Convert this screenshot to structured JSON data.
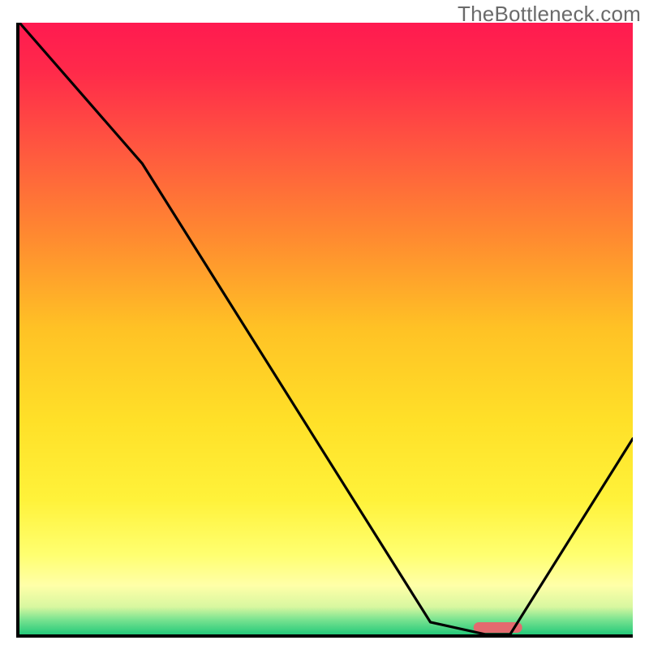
{
  "watermark": "TheBottleneck.com",
  "chart_data": {
    "type": "line",
    "title": "",
    "xlabel": "",
    "ylabel": "",
    "xlim": [
      0,
      100
    ],
    "ylim": [
      0,
      100
    ],
    "grid": false,
    "series": [
      {
        "name": "bottleneck-curve",
        "x": [
          0,
          20,
          67,
          76,
          80,
          100
        ],
        "y": [
          100,
          77,
          2,
          0,
          0,
          32
        ]
      }
    ],
    "marker": {
      "shape": "rounded-bar",
      "x": 78,
      "y": 0,
      "color": "#e46a6f"
    },
    "gradient": {
      "type": "vertical",
      "stops": [
        {
          "offset": 0.0,
          "color": "#ff1a50"
        },
        {
          "offset": 0.08,
          "color": "#ff2a4a"
        },
        {
          "offset": 0.2,
          "color": "#ff5540"
        },
        {
          "offset": 0.35,
          "color": "#ff8a30"
        },
        {
          "offset": 0.5,
          "color": "#ffc225"
        },
        {
          "offset": 0.65,
          "color": "#ffe028"
        },
        {
          "offset": 0.78,
          "color": "#fff23a"
        },
        {
          "offset": 0.87,
          "color": "#ffff70"
        },
        {
          "offset": 0.92,
          "color": "#ffffa8"
        },
        {
          "offset": 0.955,
          "color": "#d8f7a0"
        },
        {
          "offset": 0.975,
          "color": "#7de491"
        },
        {
          "offset": 1.0,
          "color": "#25c97a"
        }
      ]
    },
    "axis_color": "#000000",
    "line_color": "#000000"
  }
}
